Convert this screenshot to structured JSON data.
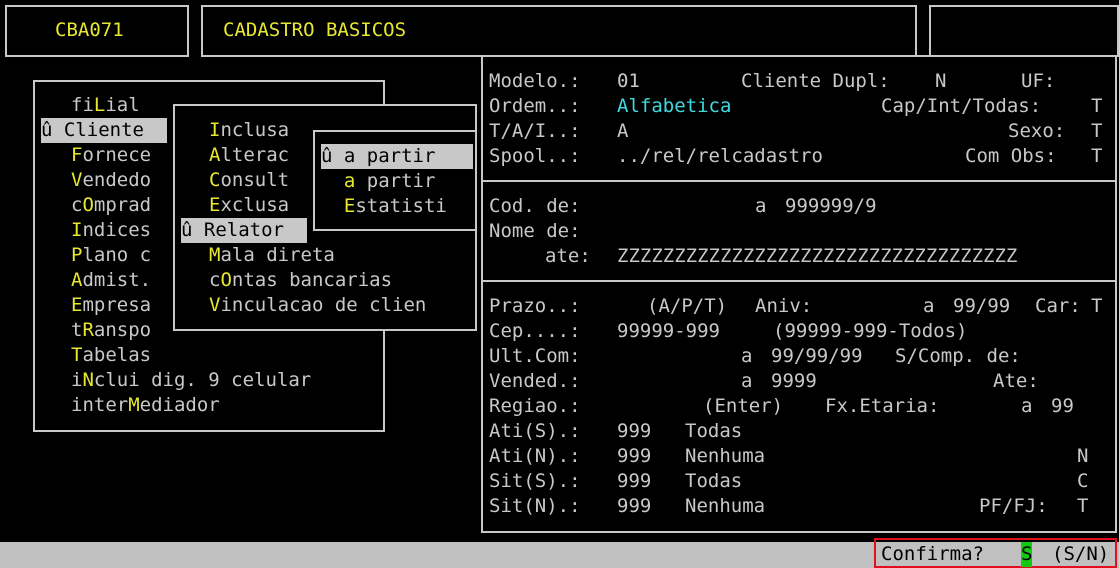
{
  "header": {
    "program_code": "CBA071",
    "title": "CADASTRO BASICOS"
  },
  "menu1": {
    "items": [
      {
        "pre": "fi",
        "key": "L",
        "post": "ial"
      },
      {
        "pre": "û ",
        "key": "C",
        "post": "liente"
      },
      {
        "pre": "",
        "key": "F",
        "post": "ornece"
      },
      {
        "pre": "",
        "key": "V",
        "post": "endedo"
      },
      {
        "pre": "c",
        "key": "O",
        "post": "mprad"
      },
      {
        "pre": "",
        "key": "I",
        "post": "ndices"
      },
      {
        "pre": "",
        "key": "P",
        "post": "lano c"
      },
      {
        "pre": "",
        "key": "A",
        "post": "dmist."
      },
      {
        "pre": "",
        "key": "E",
        "post": "mpresa"
      },
      {
        "pre": "t",
        "key": "R",
        "post": "anspo"
      },
      {
        "pre": "",
        "key": "T",
        "post": "abelas"
      },
      {
        "pre": "i",
        "key": "N",
        "post": "clui dig. 9 celular"
      },
      {
        "pre": "inter",
        "key": "M",
        "post": "ediador"
      }
    ]
  },
  "menu2": {
    "items": [
      {
        "pre": "",
        "key": "I",
        "post": "nclusa"
      },
      {
        "pre": "",
        "key": "A",
        "post": "lterac"
      },
      {
        "pre": "",
        "key": "C",
        "post": "onsult"
      },
      {
        "pre": "",
        "key": "E",
        "post": "xclusa"
      },
      {
        "pre": "û ",
        "key": "R",
        "post": "elator"
      },
      {
        "pre": "",
        "key": "M",
        "post": "ala direta"
      },
      {
        "pre": "c",
        "key": "O",
        "post": "ntas bancarias"
      },
      {
        "pre": "",
        "key": "V",
        "post": "inculacao de clien"
      }
    ]
  },
  "menu3": {
    "items": [
      {
        "pre": "û ",
        "key": "a",
        "post": " partir"
      },
      {
        "pre": "  ",
        "key": "a",
        "post": " partir"
      },
      {
        "pre": "  ",
        "key": "E",
        "post": "statisti"
      }
    ]
  },
  "form": {
    "modelo_label": "Modelo.:",
    "modelo_value": "01",
    "cliente_dupl_label": "Cliente Dupl:",
    "cliente_dupl_value": "N",
    "uf_label": "UF:",
    "ordem_label": "Ordem..:",
    "ordem_value": "Alfabetica",
    "cap_label": "Cap/Int/Todas:",
    "cap_value": "T",
    "tai_label": "T/A/I..:",
    "tai_value": "A",
    "sexo_label": "Sexo:",
    "sexo_value": "T",
    "spool_label": "Spool..:",
    "spool_value": "../rel/relcadastro",
    "com_obs_label": "Com Obs:",
    "com_obs_value": "T",
    "cod_label": "Cod. de:",
    "cod_ate": "a",
    "cod_value": "999999/9",
    "nome_label": "Nome de:",
    "nome_ate_label": "ate:",
    "nome_ate_value": "ZZZZZZZZZZZZZZZZZZZZZZZZZZZZZZZZZZZ",
    "prazo_label": "Prazo..:",
    "prazo_hint": "(A/P/T)",
    "aniv_label": "Aniv:",
    "aniv_ate": "a",
    "aniv_value": "99/99",
    "car_label": "Car:",
    "car_value": "T",
    "cep_label": "Cep....:",
    "cep_value": "99999-999",
    "cep_hint": "(99999-999-Todos)",
    "ultcom_label": "Ult.Com:",
    "ultcom_ate": "a",
    "ultcom_value": "99/99/99",
    "scomp_label": "S/Comp. de:",
    "vended_label": "Vended.:",
    "vended_ate": "a",
    "vended_value": "9999",
    "ate_label": "Ate:",
    "regiao_label": "Regiao.:",
    "regiao_hint": "(Enter)",
    "fxetaria_label": "Fx.Etaria:",
    "fxetaria_ate": "a",
    "fxetaria_value": "99",
    "atis_label": "Ati(S).:",
    "atis_value": "999",
    "atis_text": "Todas",
    "atin_label": "Ati(N).:",
    "atin_value": "999",
    "atin_text": "Nenhuma",
    "atin_flag": "N",
    "sits_label": "Sit(S).:",
    "sits_value": "999",
    "sits_text": "Todas",
    "sits_flag": "C",
    "sitn_label": "Sit(N).:",
    "sitn_value": "999",
    "sitn_text": "Nenhuma",
    "pffj_label": "PF/FJ:",
    "pffj_value": "T"
  },
  "status": {
    "confirm_label": "Confirma?",
    "confirm_value": "S",
    "confirm_options": "(S/N)"
  },
  "colors": {
    "background": "#000000",
    "text": "#c8c8c8",
    "hotkey": "#e8e830",
    "field_value_cyan": "#40d8e0",
    "highlight": "#c8c8c8",
    "confirm_border": "#e0101c",
    "confirm_value_bg": "#14c814"
  }
}
